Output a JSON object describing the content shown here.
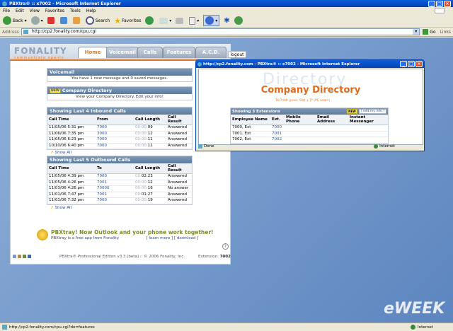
{
  "window": {
    "title": "PBXtra® :: x7002 - Microsoft Internet Explorer"
  },
  "menu": [
    "File",
    "Edit",
    "View",
    "Favorites",
    "Tools",
    "Help"
  ],
  "toolbar": {
    "back": "Back",
    "search": "Search",
    "favorites": "Favorites"
  },
  "address": {
    "label": "Address",
    "url": "http://cp2.fonality.com/cpu.cgi",
    "go": "Go",
    "links": "Links"
  },
  "app": {
    "logo": "FONALITY",
    "tagline": "communicate openly",
    "tabs": [
      "Home",
      "Voicemail",
      "Calls",
      "Features",
      "A.C.D."
    ],
    "logout": "logout"
  },
  "voicemail": {
    "title": "Voicemail",
    "message": "You have 1 new message and 0 saved messages."
  },
  "directory": {
    "badge": "NEW",
    "title": "Company Directory",
    "message": "View your Company Directory. Edit your info!"
  },
  "inbound": {
    "title": "Showing Last 4 Inbound Calls",
    "headers": [
      "Call Time",
      "From",
      "Call Length",
      "Call Result"
    ],
    "rows": [
      {
        "time": "11/05/06  5:31 pm",
        "num": "7000",
        "len_a": "00:00:",
        "len_b": "09",
        "res": "Answered"
      },
      {
        "time": "11/06/06  7:35 pm",
        "num": "3000",
        "len_a": "00:00:",
        "len_b": "12",
        "res": "Answered"
      },
      {
        "time": "11/05/06  6:23 pm",
        "num": "7000",
        "len_a": "00:00:",
        "len_b": "11",
        "res": "Answered"
      },
      {
        "time": "10/10/06  6:40 pm",
        "num": "7000",
        "len_a": "00:00:",
        "len_b": "11",
        "res": "Answered"
      }
    ],
    "show_all": "Show All"
  },
  "outbound": {
    "title": "Showing Last 5 Outbound Calls",
    "headers": [
      "Call Time",
      "To",
      "Call Length",
      "Call Result"
    ],
    "rows": [
      {
        "time": "11/05/06  4:39 pm",
        "num": "7000",
        "len_a": "00:",
        "len_b": "02:23",
        "res": "Answered"
      },
      {
        "time": "11/05/06  4:26 pm",
        "num": "7001",
        "len_a": "00:00:",
        "len_b": "12",
        "res": "Answered"
      },
      {
        "time": "11/03/06  4:26 pm",
        "num": "70000",
        "len_a": "00:00:",
        "len_b": "16",
        "res": "No answer"
      },
      {
        "time": "11/01/06  7:47 pm",
        "num": "7001",
        "len_a": "00:",
        "len_b": "01:27",
        "res": "Answered"
      },
      {
        "time": "11/01/06  7:32 pm",
        "num": "7000",
        "len_a": "00:00:",
        "len_b": "19",
        "res": "Answered"
      }
    ],
    "show_all": "Show All"
  },
  "promo": {
    "headline": "PBXtray! Now Outlook and your phone work together!",
    "sub_prefix": "PBXtray is a ",
    "sub_link": "free app from Fonality.",
    "learn": "learn more",
    "download": "download",
    "help": "?"
  },
  "footer": {
    "left": "PBXtra® Professional Edition v3.3 [beta]  ::  © 2006 Fonality, Inc.",
    "ext_label": "Extension:",
    "ext": "7002"
  },
  "popup": {
    "title": "http://cp2.fonality.com - PBXtra® :: x7002 - Microsoft Internet Explorer",
    "watermark": "Directory",
    "heading": "Company Directory",
    "print_note": "To Print: press 'Ctrl + P' (PC users)",
    "section": "Showing 3 Extensions",
    "new_badge": "NEW",
    "edit": "edit my info",
    "headers": [
      "Employee Name",
      "Ext.",
      "Mobile Phone",
      "Email Address",
      "Instant Messenger"
    ],
    "rows": [
      {
        "name": "7000, Ext",
        "ext": "7000"
      },
      {
        "name": "7001, Ext",
        "ext": "7001"
      },
      {
        "name": "7002, Ext",
        "ext": "7002"
      }
    ],
    "status_done": "Done",
    "status_zone": "Internet"
  },
  "statusbar": {
    "url": "http://cp2.fonality.com/cpu.cgi?do=features",
    "zone": "Internet"
  },
  "watermark": "eWEEK"
}
